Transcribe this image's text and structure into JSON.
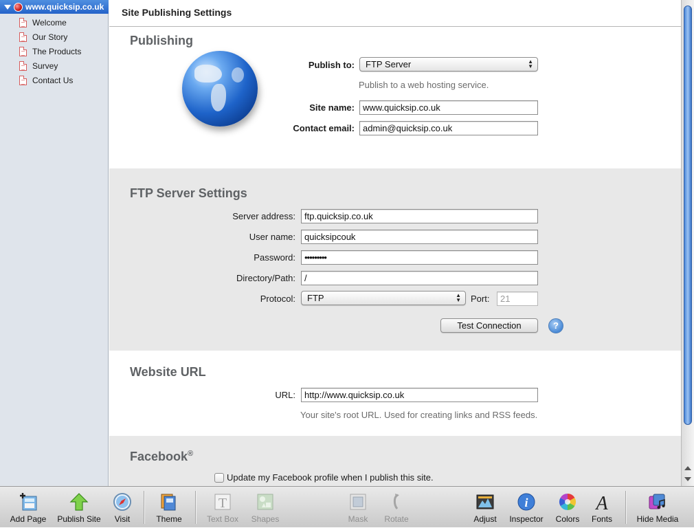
{
  "sidebar": {
    "site_name": "www.quicksip.co.uk",
    "pages": [
      "Welcome",
      "Our Story",
      "The Products",
      "Survey",
      "Contact Us"
    ]
  },
  "header": {
    "title": "Site Publishing Settings"
  },
  "publishing": {
    "title": "Publishing",
    "publish_to_label": "Publish to:",
    "publish_to_value": "FTP Server",
    "publish_hint": "Publish to a web hosting service.",
    "site_name_label": "Site name:",
    "site_name_value": "www.quicksip.co.uk",
    "contact_email_label": "Contact email:",
    "contact_email_value": "admin@quicksip.co.uk"
  },
  "ftp": {
    "title": "FTP Server Settings",
    "server_label": "Server address:",
    "server_value": "ftp.quicksip.co.uk",
    "user_label": "User name:",
    "user_value": "quicksipcouk",
    "password_label": "Password:",
    "password_value": "•••••••••",
    "path_label": "Directory/Path:",
    "path_value": "/",
    "protocol_label": "Protocol:",
    "protocol_value": "FTP",
    "port_label": "Port:",
    "port_value": "21",
    "test_button": "Test Connection",
    "help_glyph": "?"
  },
  "website_url": {
    "title": "Website URL",
    "url_label": "URL:",
    "url_value": "http://www.quicksip.co.uk",
    "url_hint": "Your site's root URL. Used for creating links and RSS feeds."
  },
  "facebook": {
    "title": "Facebook",
    "trademark": "®",
    "checkbox_label": "Update my Facebook profile when I publish this site.",
    "checked": false
  },
  "toolbar": {
    "add_page": "Add Page",
    "publish_site": "Publish Site",
    "visit": "Visit",
    "theme": "Theme",
    "text_box": "Text Box",
    "shapes": "Shapes",
    "mask": "Mask",
    "rotate": "Rotate",
    "adjust": "Adjust",
    "inspector": "Inspector",
    "colors": "Colors",
    "fonts": "Fonts",
    "hide_media": "Hide Media"
  },
  "icons": {
    "site": "globe-icon",
    "page": "page-icon",
    "help": "help-icon",
    "globe": "globe-icon"
  }
}
